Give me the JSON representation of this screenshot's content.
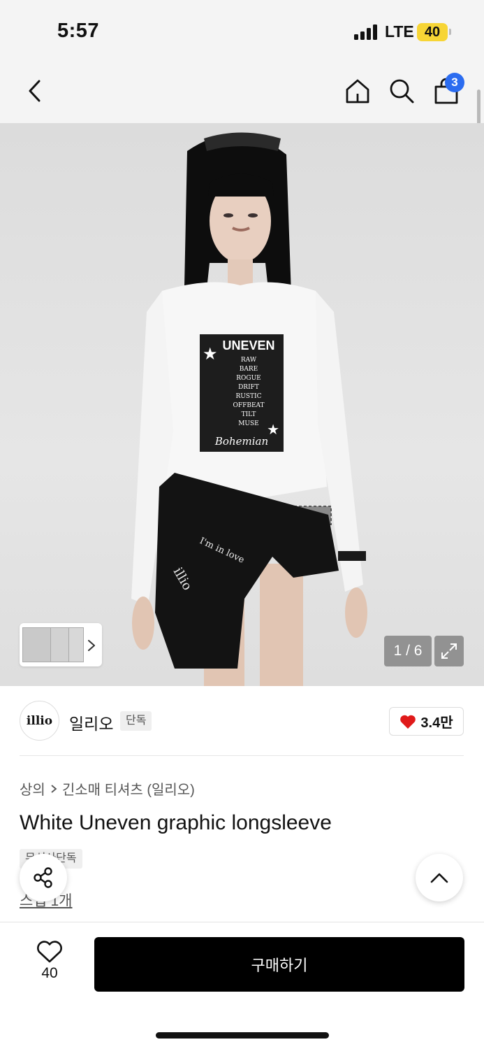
{
  "status_bar": {
    "time": "5:57",
    "network": "LTE",
    "battery": "40"
  },
  "header": {
    "cart_count": "3"
  },
  "gallery": {
    "counter": "1 / 6"
  },
  "product_graphic": {
    "headline": "UNEVEN",
    "lines": [
      "RAW",
      "BARE",
      "ROGUE",
      "DRIFT",
      "RUSTIC",
      "OFFBEAT",
      "TILT",
      "MUSE"
    ],
    "script": "Bohemian"
  },
  "brand": {
    "logo_text": "illio",
    "name": "일리오",
    "badge": "단독",
    "likes": "3.4만"
  },
  "breadcrumb": {
    "category": "상의",
    "subcategory": "긴소매 티셔츠 (일리오)"
  },
  "product": {
    "title": "White Uneven graphic longsleeve",
    "tag": "무신사단독",
    "review_link": "스냅 1개"
  },
  "bottom": {
    "wish_count": "40",
    "buy_label": "구매하기"
  },
  "colors": {
    "accent_badge": "#2b6cf0",
    "battery": "#f7d535",
    "heart": "#e01a1a",
    "buy_button": "#000000"
  }
}
